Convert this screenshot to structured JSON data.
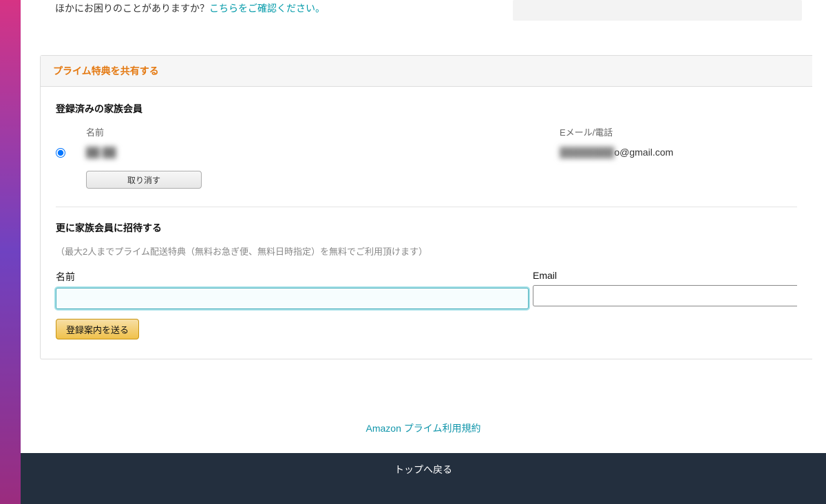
{
  "help": {
    "prefix": "ほかにお困りのことがありますか？",
    "link_text": "こちらをご確認ください。"
  },
  "card": {
    "title": "プライム特典を共有する"
  },
  "registered": {
    "heading": "登録済みの家族会員",
    "columns": {
      "name": "名前",
      "email": "Eメール/電話"
    },
    "member": {
      "name_masked": "██ ██",
      "email_masked_prefix": "████████",
      "email_suffix": "o@gmail.com"
    },
    "cancel_button": "取り消す"
  },
  "invite": {
    "heading": "更に家族会員に招待する",
    "subtext": "（最大2人までプライム配送特典（無料お急ぎ便、無料日時指定）を無料でご利用頂けます）",
    "name_label": "名前",
    "email_label": "Email",
    "send_button": "登録案内を送る"
  },
  "footer": {
    "terms_link": "Amazon プライム利用規約",
    "back_to_top": "トップへ戻る"
  }
}
